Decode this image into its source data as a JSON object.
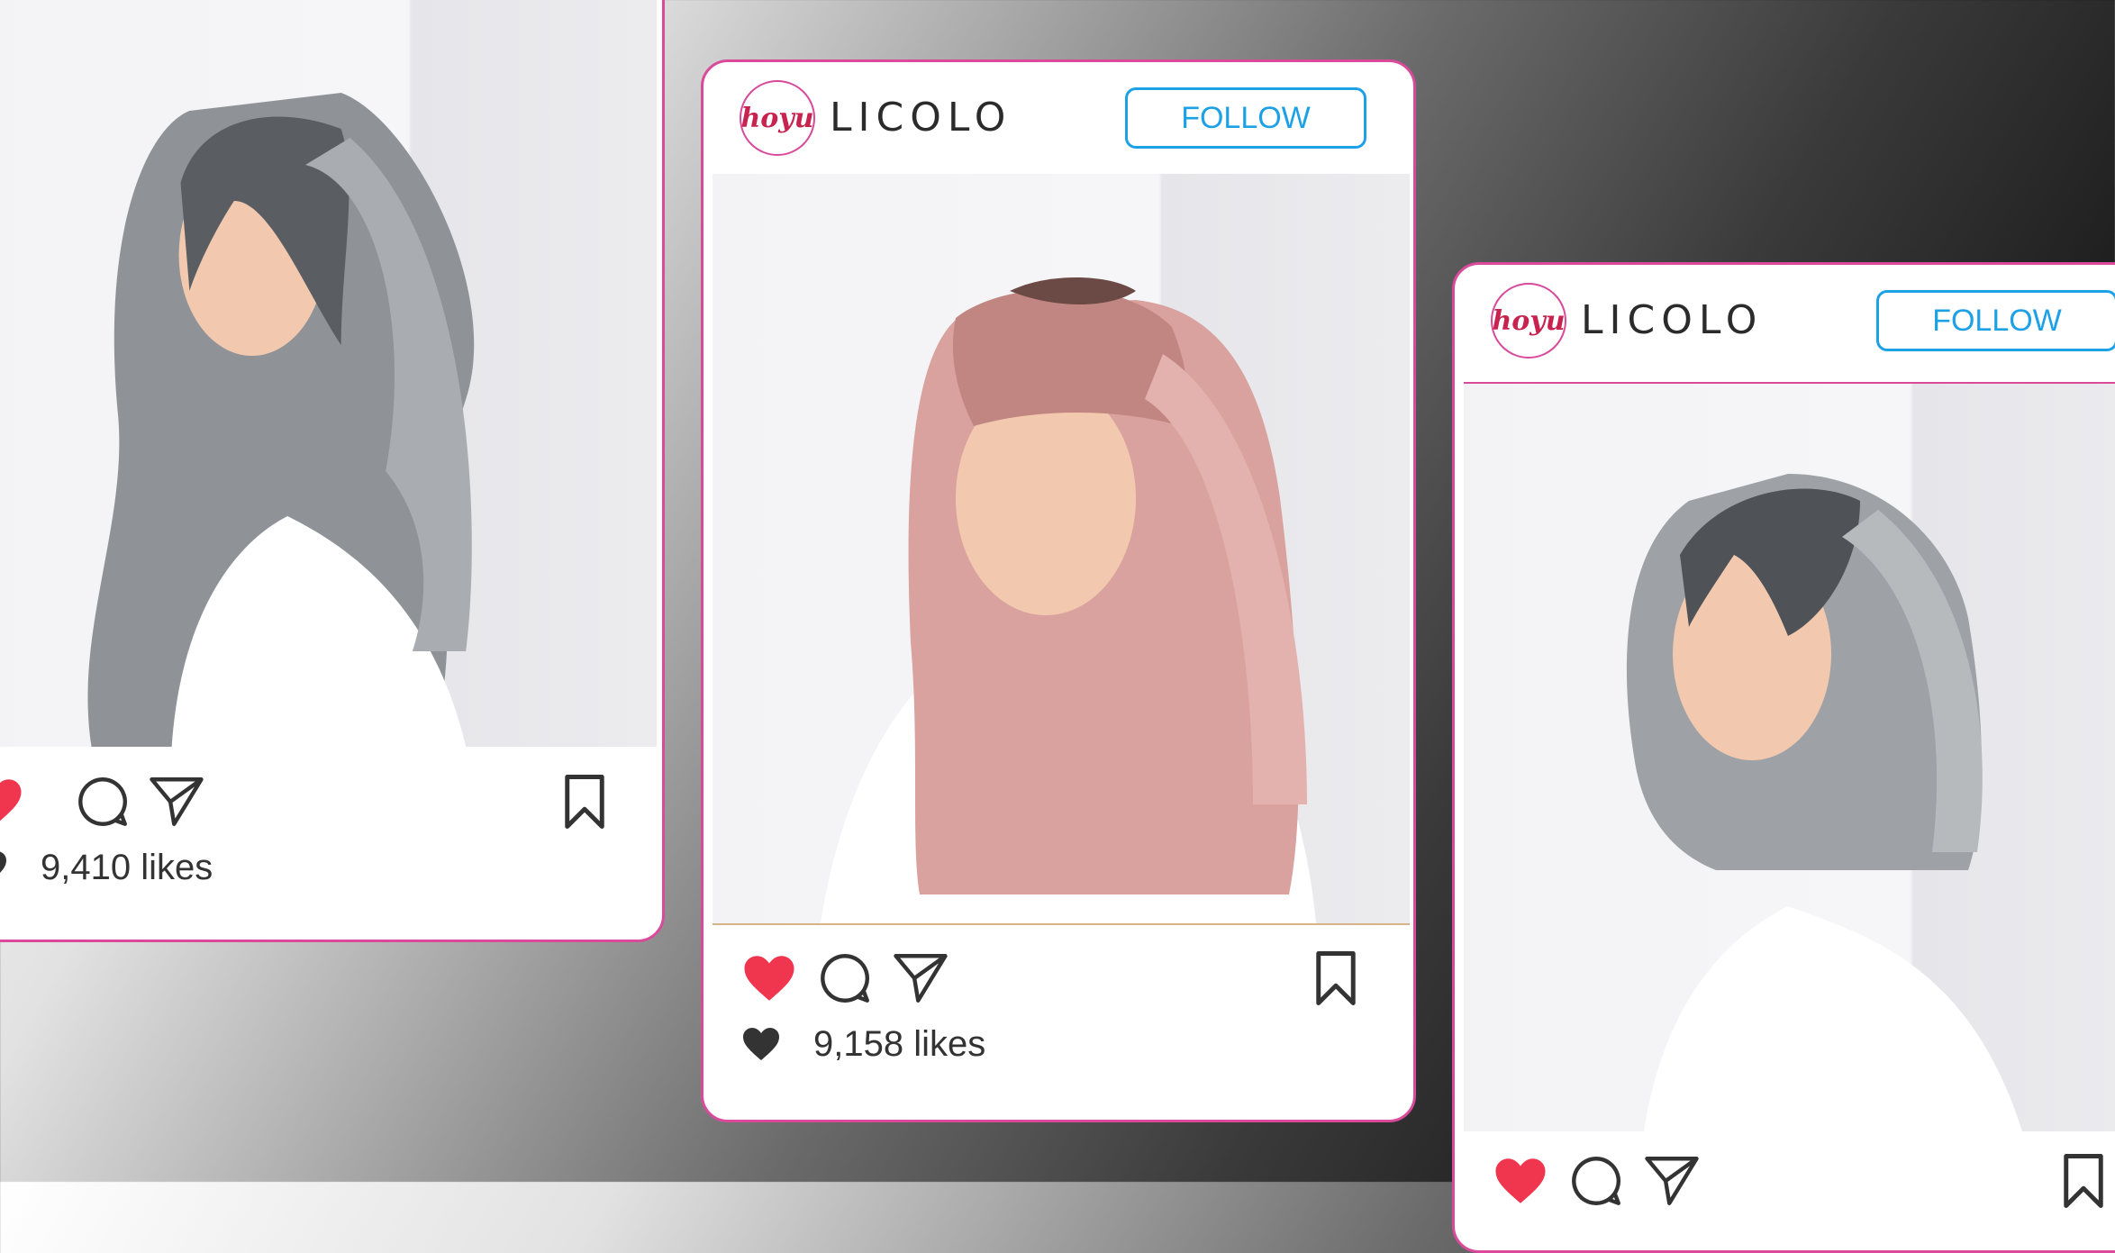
{
  "colors": {
    "accent_pink": "#d94a9b",
    "follow_blue": "#1da1e6",
    "like_red": "#f0364f",
    "icon_dark": "#333333"
  },
  "posts": [
    {
      "brand_logo": "hoyu",
      "brand_name": "LICOLO",
      "follow_label": "FOLLOW",
      "hair_color": "ash grey",
      "liked": true,
      "likes_text": "9,410 likes"
    },
    {
      "brand_logo": "hoyu",
      "brand_name": "LICOLO",
      "follow_label": "FOLLOW",
      "hair_color": "rose pink",
      "liked": true,
      "likes_text": "9,158 likes"
    },
    {
      "brand_logo": "hoyu",
      "brand_name": "LICOLO",
      "follow_label": "FOLLOW",
      "hair_color": "ash grey bob",
      "liked": true,
      "likes_text": ""
    }
  ],
  "icons": [
    "heart-icon",
    "comment-icon",
    "share-icon",
    "bookmark-icon",
    "heart-filled-icon"
  ]
}
